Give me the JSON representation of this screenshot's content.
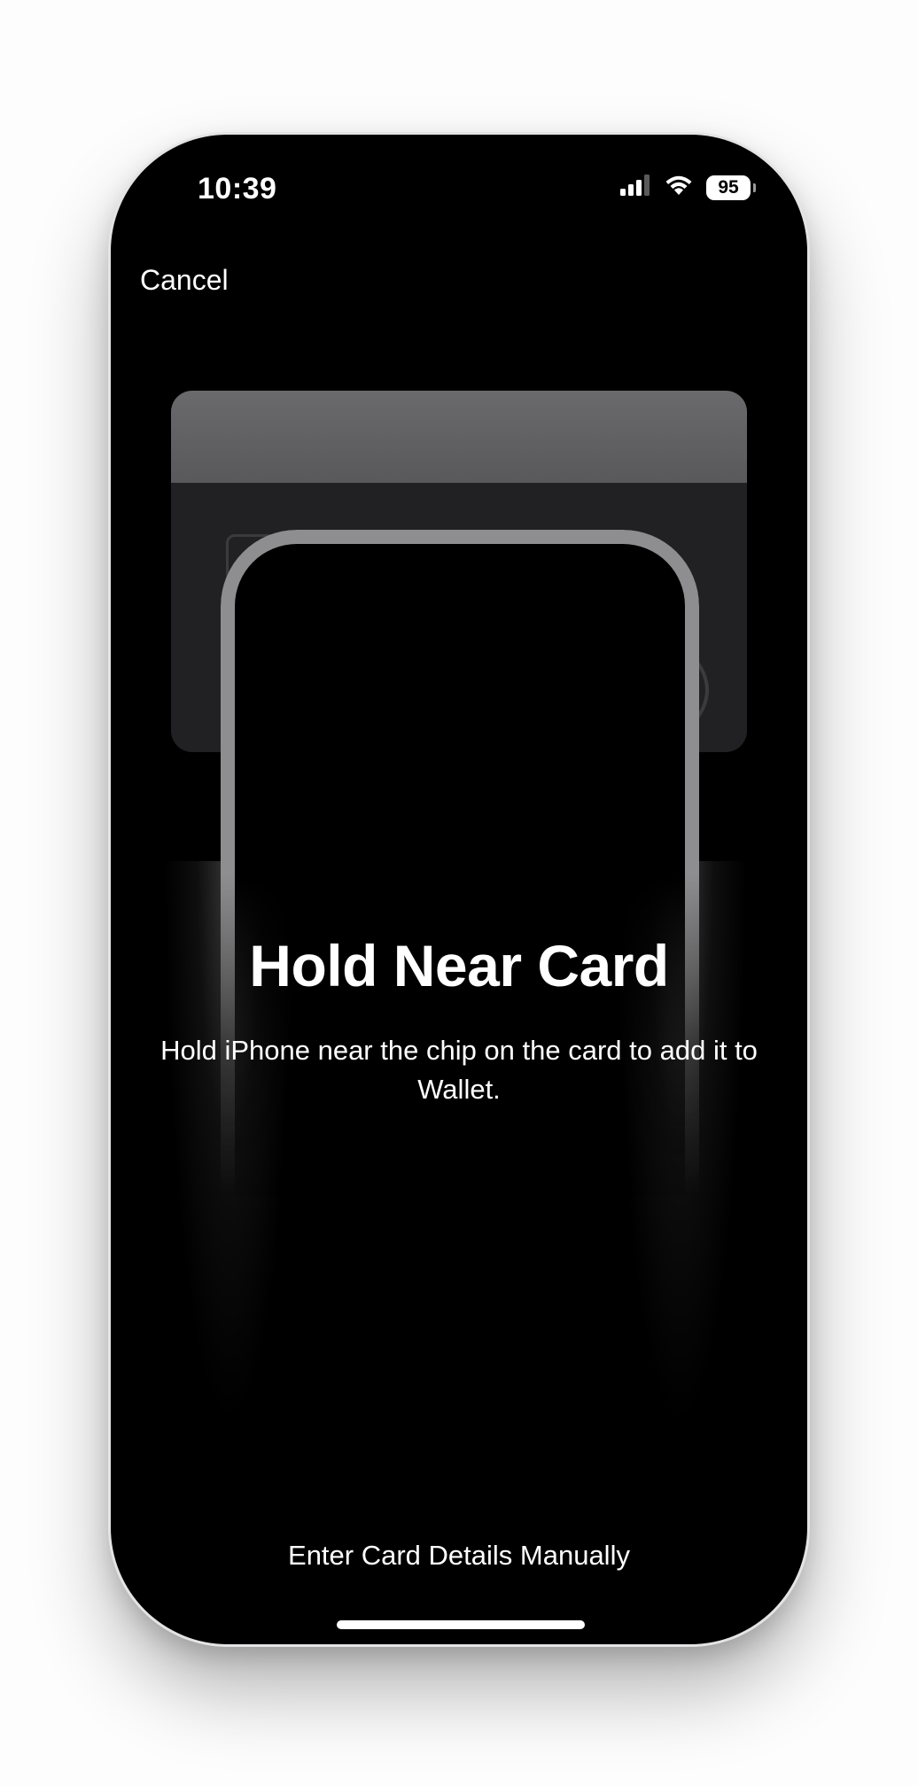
{
  "status_bar": {
    "time": "10:39",
    "battery_level": "95",
    "icons": [
      "cellular-signal-icon",
      "wifi-icon",
      "battery-icon"
    ]
  },
  "nav": {
    "cancel_label": "Cancel"
  },
  "illustration": {
    "icons": [
      "credit-card-icon",
      "card-chip-icon",
      "contactless-icon",
      "iphone-outline-icon"
    ]
  },
  "content": {
    "title": "Hold Near Card",
    "subtitle": "Hold iPhone near the chip on the card to add it to Wallet."
  },
  "footer": {
    "manual_entry_label": "Enter Card Details Manually"
  },
  "colors": {
    "background": "#000000",
    "text": "#ffffff",
    "card": "#212123",
    "card_stripe": "#6a6a6c",
    "phone_outline": "#8e8e90"
  }
}
